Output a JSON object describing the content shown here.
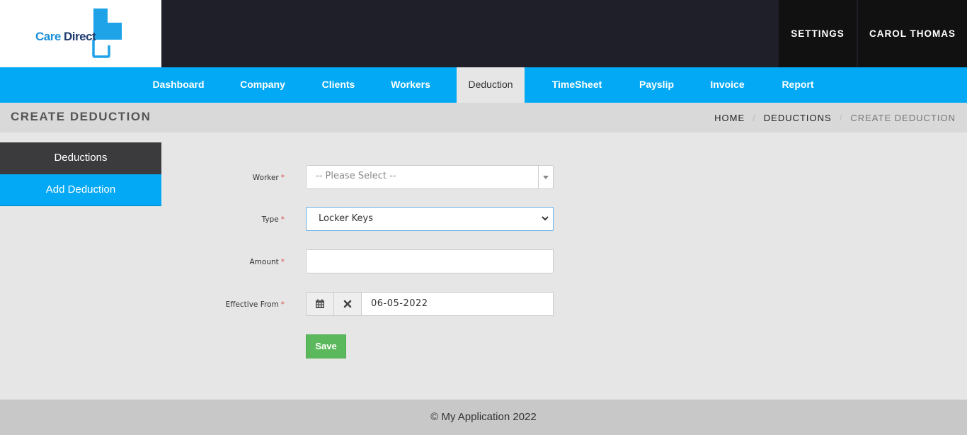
{
  "brand": {
    "name_part1": "Care ",
    "name_part2": "Direct",
    "colors": {
      "primary": "#03a9f4",
      "dark": "#1e1f29",
      "save": "#5cb85c"
    }
  },
  "top_nav": {
    "settings": "SETTINGS",
    "user": "CAROL THOMAS"
  },
  "main_nav": [
    {
      "label": "Dashboard"
    },
    {
      "label": "Company"
    },
    {
      "label": "Clients"
    },
    {
      "label": "Workers"
    },
    {
      "label": "Deduction",
      "active": true
    },
    {
      "label": "TimeSheet"
    },
    {
      "label": "Payslip"
    },
    {
      "label": "Invoice"
    },
    {
      "label": "Report"
    }
  ],
  "page": {
    "title": "CREATE DEDUCTION",
    "breadcrumb": [
      "HOME",
      "DEDUCTIONS",
      "CREATE DEDUCTION"
    ]
  },
  "sidebar": {
    "header": "Deductions",
    "items": [
      {
        "label": "Add Deduction",
        "active": true
      }
    ]
  },
  "form": {
    "worker": {
      "label": "Worker",
      "required": "*",
      "placeholder": "-- Please Select --"
    },
    "type": {
      "label": "Type",
      "required": "*",
      "value": "Locker Keys"
    },
    "amount": {
      "label": "Amount",
      "required": "*",
      "value": ""
    },
    "effective_from": {
      "label": "Effective From",
      "required": "*",
      "value": "06-05-2022",
      "icons": [
        "calendar-icon",
        "clear-icon"
      ]
    },
    "save_label": "Save"
  },
  "footer": {
    "text": "© My Application 2022"
  }
}
